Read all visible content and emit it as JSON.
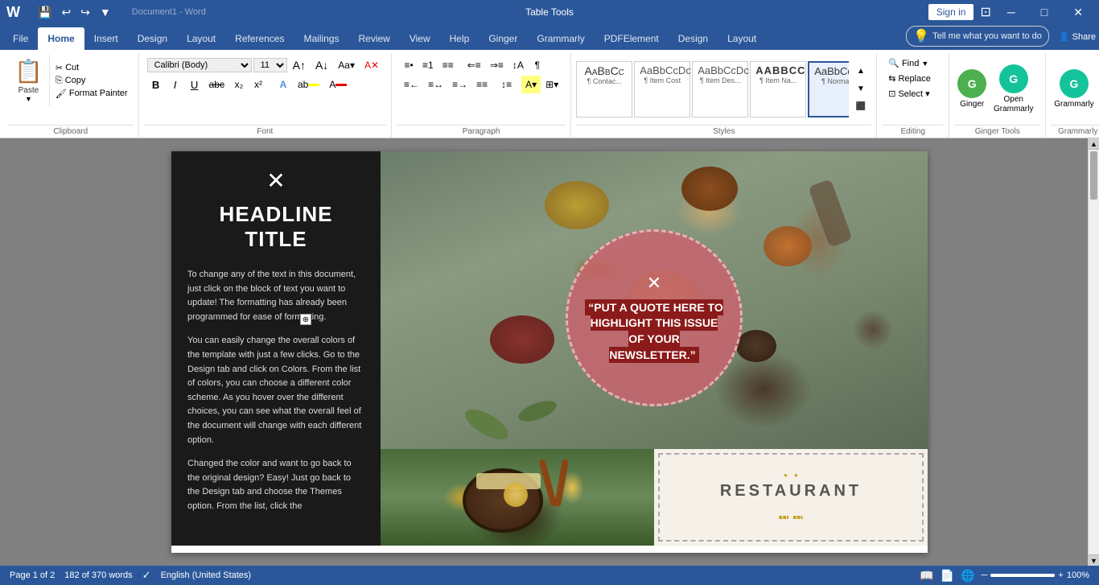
{
  "titlebar": {
    "doc_name": "Document1 - Word",
    "table_tools": "Table Tools",
    "sign_in": "Sign in",
    "controls": [
      "─",
      "□",
      "✕"
    ],
    "quick_access": [
      "💾",
      "↩",
      "↪",
      "▼"
    ]
  },
  "ribbon_tabs": {
    "active": "Home",
    "tabs": [
      "File",
      "Home",
      "Insert",
      "Design",
      "Layout",
      "References",
      "Mailings",
      "Review",
      "View",
      "Help",
      "Ginger",
      "Grammarly",
      "PDFElement",
      "Design",
      "Layout"
    ]
  },
  "ribbon": {
    "clipboard": {
      "label": "Clipboard",
      "paste": "Paste",
      "cut": "Cut",
      "copy": "Copy",
      "format_painter": "Format Painter"
    },
    "font": {
      "label": "Font",
      "family": "Calibri (Body)",
      "size": "11",
      "bold": "B",
      "italic": "I",
      "underline": "U",
      "strikethrough": "abc",
      "subscript": "x₂",
      "superscript": "x²"
    },
    "paragraph": {
      "label": "Paragraph"
    },
    "styles": {
      "label": "Styles",
      "items": [
        {
          "id": "aabbcc",
          "label": "AaBbCc",
          "sublabel": "¶ Contac..."
        },
        {
          "id": "aabbccdc1",
          "label": "AaBbCcDc",
          "sublabel": "¶ Item Cost"
        },
        {
          "id": "aabbccdc2",
          "label": "AaBbCcDc",
          "sublabel": "¶ Item Des..."
        },
        {
          "id": "aabbcc2",
          "label": "AABBCC",
          "sublabel": "¶ Item Na..."
        },
        {
          "id": "aabbccdc3",
          "label": "AaBbCcDc",
          "sublabel": "¶ Normal",
          "active": true
        }
      ]
    },
    "editing": {
      "label": "Editing",
      "find": "Find",
      "replace": "Replace",
      "select": "Select ▾"
    },
    "ginger": {
      "label": "Ginger Tools",
      "button": "Ginger",
      "open_grammarly": "Open Grammarly"
    },
    "grammarly": {
      "label": "Grammarly",
      "button": "Grammarly"
    }
  },
  "tell_me": {
    "placeholder": "Tell me what you want to do"
  },
  "share": {
    "label": "Share"
  },
  "document": {
    "table_tools_context": "Table Tools",
    "page": {
      "left_panel": {
        "icon": "✕",
        "headline": "HEADLINE TITLE",
        "paragraphs": [
          "To change any of the text in this document, just click on the block of text you want to update!  The formatting has already been programmed for ease of formatting.",
          "You can easily change the overall colors of the template with just a few clicks.  Go to the Design tab and click on Colors.  From the list of colors, you can choose a different color scheme.  As you hover over the different choices, you can see what the overall feel of the document will change with each different option.",
          "Changed the color and want to go back to the original design?  Easy!  Just go back to the Design tab and choose the Themes option.  From the list, click the"
        ]
      },
      "circle_quote": {
        "icon": "✕",
        "text": "“PUT A QUOTE HERE TO HIGHLIGHT THIS ISSUE OF YOUR NEWSLETTER.”"
      },
      "restaurant": {
        "name": "RESTAURANT",
        "fork_knife": "⑉"
      }
    }
  },
  "status_bar": {
    "page_info": "Page 1 of 2",
    "word_count": "182 of 370 words",
    "language": "English (United States)",
    "zoom": "100%"
  }
}
